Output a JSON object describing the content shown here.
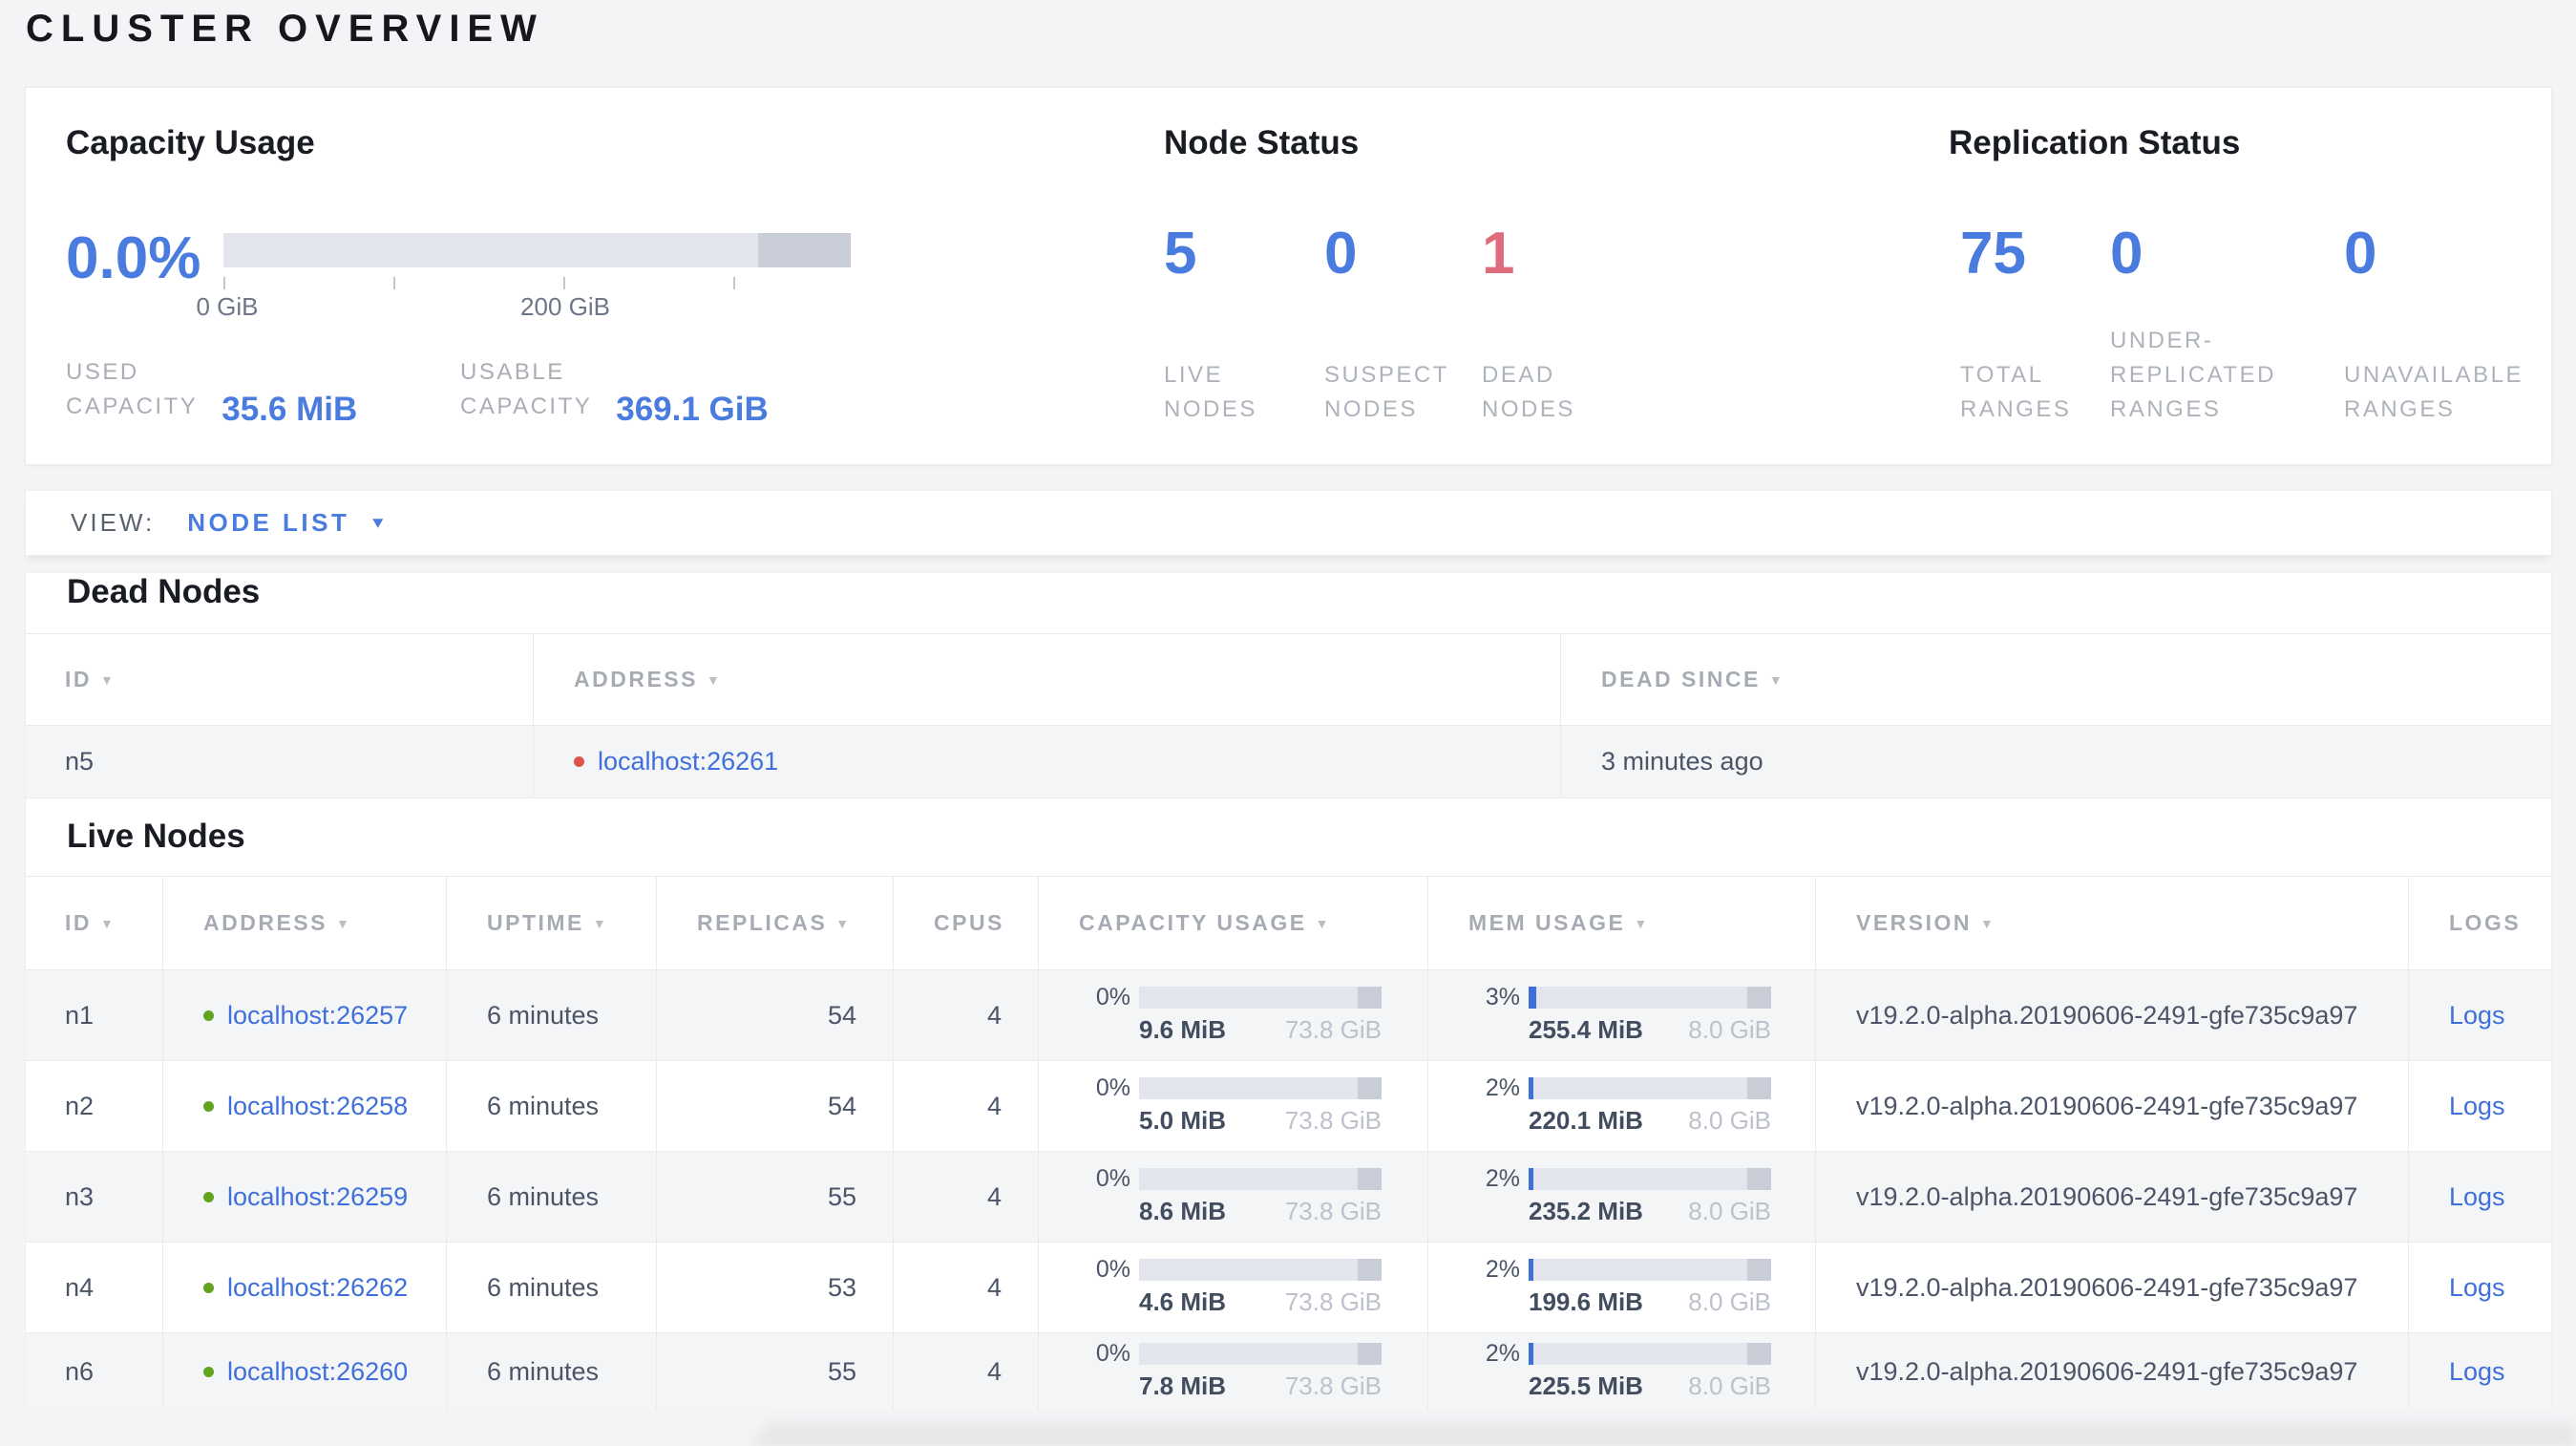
{
  "page": {
    "title": "CLUSTER OVERVIEW"
  },
  "colors": {
    "accent_blue": "#4a7ce0",
    "link_blue": "#3e6fdb",
    "dead_red": "#df6c7c",
    "dot_red": "#dd544c",
    "dot_green": "#62a420",
    "bar_track": "#e3e5ed",
    "bar_reserved": "#c9cdd8",
    "page_bg": "#f4f4f6",
    "panel_bg": "#ffffff"
  },
  "summary": {
    "capacity": {
      "heading": "Capacity Usage",
      "percent": "0.0%",
      "tick_labels": [
        "0 GiB",
        "200 GiB"
      ],
      "used_label": "USED\nCAPACITY",
      "used_value": "35.6 MiB",
      "usable_label": "USABLE\nCAPACITY",
      "usable_value": "369.1 GiB"
    },
    "node_status": {
      "heading": "Node Status",
      "items": [
        {
          "value": "5",
          "label": "LIVE\nNODES",
          "tone": "blue"
        },
        {
          "value": "0",
          "label": "SUSPECT\nNODES",
          "tone": "blue"
        },
        {
          "value": "1",
          "label": "DEAD\nNODES",
          "tone": "red"
        }
      ]
    },
    "replication": {
      "heading": "Replication Status",
      "items": [
        {
          "value": "75",
          "label": "TOTAL\nRANGES",
          "tone": "blue"
        },
        {
          "value": "0",
          "label": "UNDER-\nREPLICATED\nRANGES",
          "tone": "blue"
        },
        {
          "value": "0",
          "label": "UNAVAILABLE\nRANGES",
          "tone": "blue"
        }
      ]
    }
  },
  "view_bar": {
    "label": "VIEW:",
    "selected": "NODE LIST"
  },
  "dead_nodes": {
    "heading": "Dead Nodes",
    "columns": [
      {
        "label": "ID",
        "sortable": true
      },
      {
        "label": "ADDRESS",
        "sortable": true
      },
      {
        "label": "DEAD SINCE",
        "sortable": true
      }
    ],
    "rows": [
      {
        "id": "n5",
        "address": "localhost:26261",
        "dead_since": "3 minutes ago"
      }
    ]
  },
  "live_nodes": {
    "heading": "Live Nodes",
    "columns": [
      {
        "label": "ID",
        "sortable": true
      },
      {
        "label": "ADDRESS",
        "sortable": true
      },
      {
        "label": "UPTIME",
        "sortable": true
      },
      {
        "label": "REPLICAS",
        "sortable": true
      },
      {
        "label": "CPUS",
        "sortable": false
      },
      {
        "label": "CAPACITY USAGE",
        "sortable": true
      },
      {
        "label": "MEM USAGE",
        "sortable": true
      },
      {
        "label": "VERSION",
        "sortable": true
      },
      {
        "label": "LOGS",
        "sortable": false
      }
    ],
    "rows": [
      {
        "id": "n1",
        "address": "localhost:26257",
        "uptime": "6 minutes",
        "replicas": "54",
        "cpus": "4",
        "capacity": {
          "percent": "0%",
          "used": "9.6 MiB",
          "total": "73.8 GiB"
        },
        "memory": {
          "percent": "3%",
          "used": "255.4 MiB",
          "total": "8.0 GiB"
        },
        "version": "v19.2.0-alpha.20190606-2491-gfe735c9a97",
        "logs": "Logs"
      },
      {
        "id": "n2",
        "address": "localhost:26258",
        "uptime": "6 minutes",
        "replicas": "54",
        "cpus": "4",
        "capacity": {
          "percent": "0%",
          "used": "5.0 MiB",
          "total": "73.8 GiB"
        },
        "memory": {
          "percent": "2%",
          "used": "220.1 MiB",
          "total": "8.0 GiB"
        },
        "version": "v19.2.0-alpha.20190606-2491-gfe735c9a97",
        "logs": "Logs"
      },
      {
        "id": "n3",
        "address": "localhost:26259",
        "uptime": "6 minutes",
        "replicas": "55",
        "cpus": "4",
        "capacity": {
          "percent": "0%",
          "used": "8.6 MiB",
          "total": "73.8 GiB"
        },
        "memory": {
          "percent": "2%",
          "used": "235.2 MiB",
          "total": "8.0 GiB"
        },
        "version": "v19.2.0-alpha.20190606-2491-gfe735c9a97",
        "logs": "Logs"
      },
      {
        "id": "n4",
        "address": "localhost:26262",
        "uptime": "6 minutes",
        "replicas": "53",
        "cpus": "4",
        "capacity": {
          "percent": "0%",
          "used": "4.6 MiB",
          "total": "73.8 GiB"
        },
        "memory": {
          "percent": "2%",
          "used": "199.6 MiB",
          "total": "8.0 GiB"
        },
        "version": "v19.2.0-alpha.20190606-2491-gfe735c9a97",
        "logs": "Logs"
      },
      {
        "id": "n6",
        "address": "localhost:26260",
        "uptime": "6 minutes",
        "replicas": "55",
        "cpus": "4",
        "capacity": {
          "percent": "0%",
          "used": "7.8 MiB",
          "total": "73.8 GiB"
        },
        "memory": {
          "percent": "2%",
          "used": "225.5 MiB",
          "total": "8.0 GiB"
        },
        "version": "v19.2.0-alpha.20190606-2491-gfe735c9a97",
        "logs": "Logs"
      }
    ]
  }
}
